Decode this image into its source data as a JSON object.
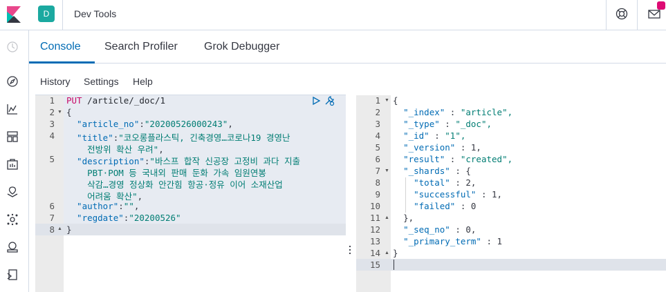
{
  "app": {
    "title": "Dev Tools",
    "space_initial": "D"
  },
  "colors": {
    "accent": "#006bb4",
    "space": "#1ba9a0",
    "badge": "#dd0a73"
  },
  "tabs": [
    {
      "label": "Console",
      "active": true
    },
    {
      "label": "Search Profiler",
      "active": false
    },
    {
      "label": "Grok Debugger",
      "active": false
    }
  ],
  "submenu": [
    "History",
    "Settings",
    "Help"
  ],
  "nav_icons": [
    "clock-icon",
    "compass-icon",
    "visualize-icon",
    "dashboard-icon",
    "canvas-icon",
    "maps-icon",
    "ml-icon",
    "infrastructure-icon",
    "logs-icon"
  ],
  "request": {
    "line_numbers": [
      "1",
      "2",
      "3",
      "4",
      "5",
      "6",
      "7",
      "8"
    ],
    "method": "PUT",
    "url": " /article/_doc/1",
    "lines": {
      "l2": "{",
      "l3_key": "  \"article_no\"",
      "l3_val": "\"20200526000243\"",
      "l4_key": "  \"title\"",
      "l4_val": "\"코오롱플라스틱, 긴축경영…코로나19 경영난",
      "l4_cont": "    전방위 확산 우려\"",
      "l5_key": "  \"description\"",
      "l5_val": "\"바스프 합작 신공장 고정비 과다 지출",
      "l5_cont1": "    PBT·POM 등 국내외 판매 둔화 가속 임원연봉",
      "l5_cont2": "    삭감…경영 정상화 안간힘 항공·정유 이어 소재산업",
      "l5_cont3": "    어려움 확산\"",
      "l6_key": "  \"author\"",
      "l6_val": "\"\"",
      "l7_key": "  \"regdate\"",
      "l7_val": "\"20200526\"",
      "l8": "}"
    }
  },
  "response": {
    "line_numbers": [
      "1",
      "2",
      "3",
      "4",
      "5",
      "6",
      "7",
      "8",
      "9",
      "10",
      "11",
      "12",
      "13",
      "14",
      "15"
    ],
    "lines": [
      {
        "key": "",
        "sep": "",
        "val": "{",
        "indent": ""
      },
      {
        "key": "\"_index\"",
        "sep": " : ",
        "val": "\"article\",",
        "indent": "  "
      },
      {
        "key": "\"_type\"",
        "sep": " : ",
        "val": "\"_doc\",",
        "indent": "  "
      },
      {
        "key": "\"_id\"",
        "sep": " : ",
        "val": "\"1\",",
        "indent": "  "
      },
      {
        "key": "\"_version\"",
        "sep": " : ",
        "val": "1,",
        "indent": "  "
      },
      {
        "key": "\"result\"",
        "sep": " : ",
        "val": "\"created\",",
        "indent": "  "
      },
      {
        "key": "\"_shards\"",
        "sep": " : ",
        "val": "{",
        "indent": "  "
      },
      {
        "key": "\"total\"",
        "sep": " : ",
        "val": "2,",
        "indent": "    "
      },
      {
        "key": "\"successful\"",
        "sep": " : ",
        "val": "1,",
        "indent": "    "
      },
      {
        "key": "\"failed\"",
        "sep": " : ",
        "val": "0",
        "indent": "    "
      },
      {
        "key": "",
        "sep": "",
        "val": "},",
        "indent": "  "
      },
      {
        "key": "\"_seq_no\"",
        "sep": " : ",
        "val": "0,",
        "indent": "  "
      },
      {
        "key": "\"_primary_term\"",
        "sep": " : ",
        "val": "1",
        "indent": "  "
      },
      {
        "key": "",
        "sep": "",
        "val": "}",
        "indent": ""
      },
      {
        "key": "",
        "sep": "",
        "val": "",
        "indent": ""
      }
    ]
  }
}
